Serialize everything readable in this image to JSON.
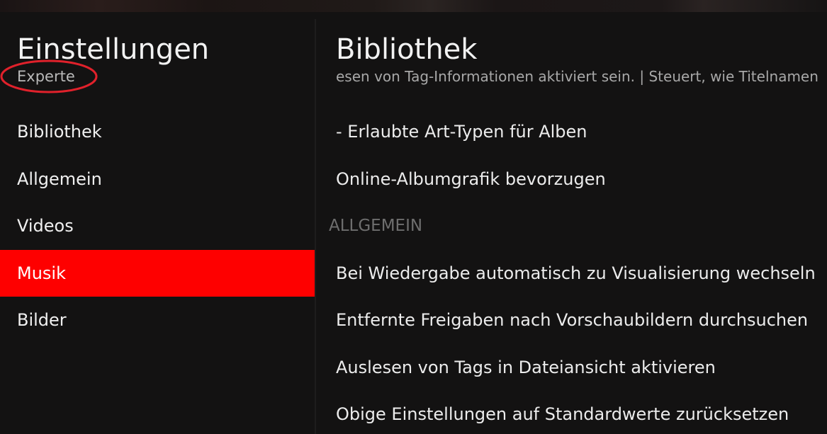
{
  "header": {
    "title": "Einstellungen",
    "level": "Experte"
  },
  "sidebar": {
    "items": [
      {
        "label": "Bibliothek",
        "active": false
      },
      {
        "label": "Allgemein",
        "active": false
      },
      {
        "label": "Videos",
        "active": false
      },
      {
        "label": "Musik",
        "active": true
      },
      {
        "label": "Bilder",
        "active": false
      }
    ]
  },
  "content": {
    "title": "Bibliothek",
    "description": "esen von Tag-Informationen aktiviert sein. | Steuert, wie Titelnamen",
    "rows": [
      {
        "label": "- Erlaubte Art-Typen für Alben"
      },
      {
        "label": "Online-Albumgrafik bevorzugen"
      }
    ],
    "group_header": "ALLGEMEIN",
    "general_rows": [
      {
        "label": "Bei Wiedergabe automatisch zu Visualisierung wechseln"
      },
      {
        "label": "Entfernte Freigaben nach Vorschaubildern durchsuchen"
      },
      {
        "label": "Auslesen von Tags in Dateiansicht aktivieren"
      },
      {
        "label": "Obige Einstellungen auf Standardwerte zurücksetzen"
      }
    ]
  },
  "colors": {
    "accent": "#fe0000",
    "background": "#131212",
    "annotation": "#e0212b"
  }
}
